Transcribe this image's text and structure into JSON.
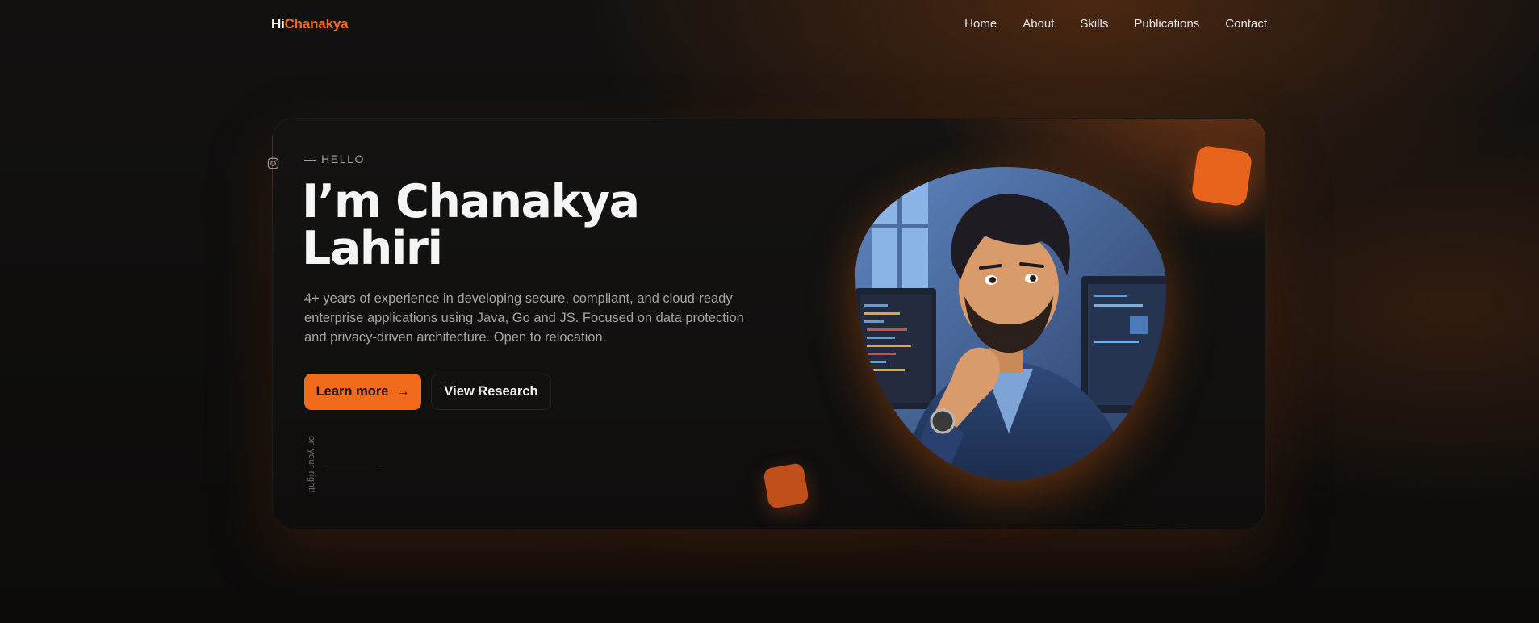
{
  "brand": {
    "prefix": "Hi",
    "name": "Chanakya"
  },
  "nav": {
    "links": [
      {
        "label": "Home"
      },
      {
        "label": "About"
      },
      {
        "label": "Skills"
      },
      {
        "label": "Publications"
      },
      {
        "label": "Contact"
      }
    ]
  },
  "hero": {
    "eyebrow": "— HELLO",
    "title_line1": "I’m Chanakya",
    "title_line2": "Lahiri",
    "description": "4+ years of experience in developing secure, compliant, and cloud-ready enterprise applications using Java, Go and JS. Focused on data protection and privacy-driven architecture. Open to relocation.",
    "primary_cta": "Learn more",
    "primary_cta_icon": "arrow-right-icon",
    "secondary_cta": "View Research",
    "side_note": "on your right!",
    "social_icon": "instagram-icon"
  },
  "colors": {
    "accent": "#f26b1d",
    "background": "#0f0e0d",
    "card": "#141312",
    "muted_text": "#a7a39f"
  }
}
